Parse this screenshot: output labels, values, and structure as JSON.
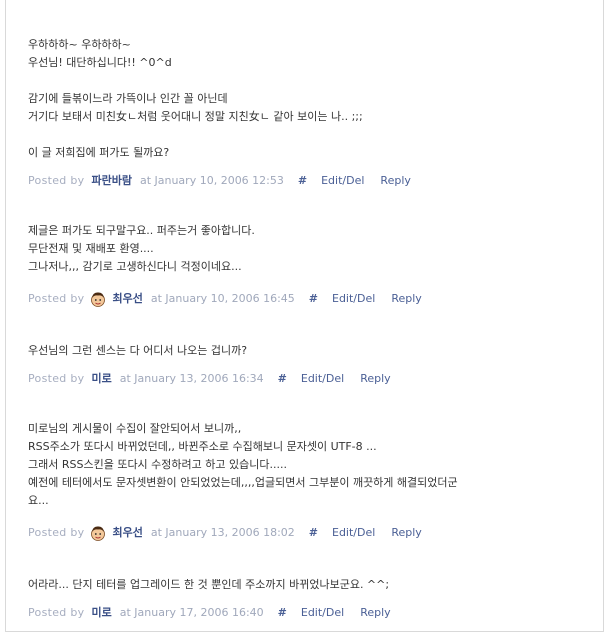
{
  "comments": [
    {
      "lines": [
        "우하하하~ 우하하하~",
        "우선님! 대단하십니다!! ^0^d",
        "",
        "감기에 들볶이느라 가뜩이나 인간 꼴 아닌데",
        "거기다 보태서 미친女ㄴ처럼 웃어대니 정말 지친女ㄴ 같아 보이는 나.. ;;;",
        "",
        "이 글 저희집에 퍼가도 될까요?"
      ],
      "posted_by": "Posted by",
      "author": "파란바람",
      "date": "at January 10, 2006 12:53",
      "permalink": "#",
      "edit": "Edit/Del",
      "reply": "Reply",
      "has_avatar": false
    },
    {
      "lines": [
        "제글은 퍼가도 되구말구요.. 퍼주는거 좋아합니다.",
        "무단전재 및 재배포 환영....",
        "그나저나,,, 감기로 고생하신다니 걱정이네요..."
      ],
      "posted_by": "Posted by",
      "author": "최우선",
      "date": "at January 10, 2006 16:45",
      "permalink": "#",
      "edit": "Edit/Del",
      "reply": "Reply",
      "has_avatar": true
    },
    {
      "lines": [
        "우선님의 그런 센스는 다 어디서 나오는 겁니까?"
      ],
      "posted_by": "Posted by",
      "author": "미로",
      "date": "at January 13, 2006 16:34",
      "permalink": "#",
      "edit": "Edit/Del",
      "reply": "Reply",
      "has_avatar": false
    },
    {
      "lines": [
        "미로님의 게시물이 수집이 잘안되어서 보니까,,",
        "RSS주소가 또다시 바뀌었던데,, 바뀐주소로 수집해보니 문자셋이 UTF-8 ...",
        "그래서 RSS스킨을 또다시 수정하려고 하고 있습니다.....",
        "예전에 테터에서도 문자셋변환이 안되었었는데,,,,업글되면서 그부분이 깨끗하게 해결되었더군",
        "요..."
      ],
      "posted_by": "Posted by",
      "author": "최우선",
      "date": "at January 13, 2006 18:02",
      "permalink": "#",
      "edit": "Edit/Del",
      "reply": "Reply",
      "has_avatar": true
    },
    {
      "lines": [
        "어라라... 단지 테터를 업그레이드 한 것 뿐인데 주소까지 바뀌었나보군요. ^^;"
      ],
      "posted_by": "Posted by",
      "author": "미로",
      "date": "at January 17, 2006 16:40",
      "permalink": "#",
      "edit": "Edit/Del",
      "reply": "Reply",
      "has_avatar": false
    }
  ],
  "colors": {
    "body_text": "#333333",
    "meta_text": "#a0a8bb",
    "author": "#3a4f86",
    "link": "#4a5f95",
    "border": "#d9d9d9"
  },
  "icons": {
    "avatar": "user-avatar-icon"
  }
}
